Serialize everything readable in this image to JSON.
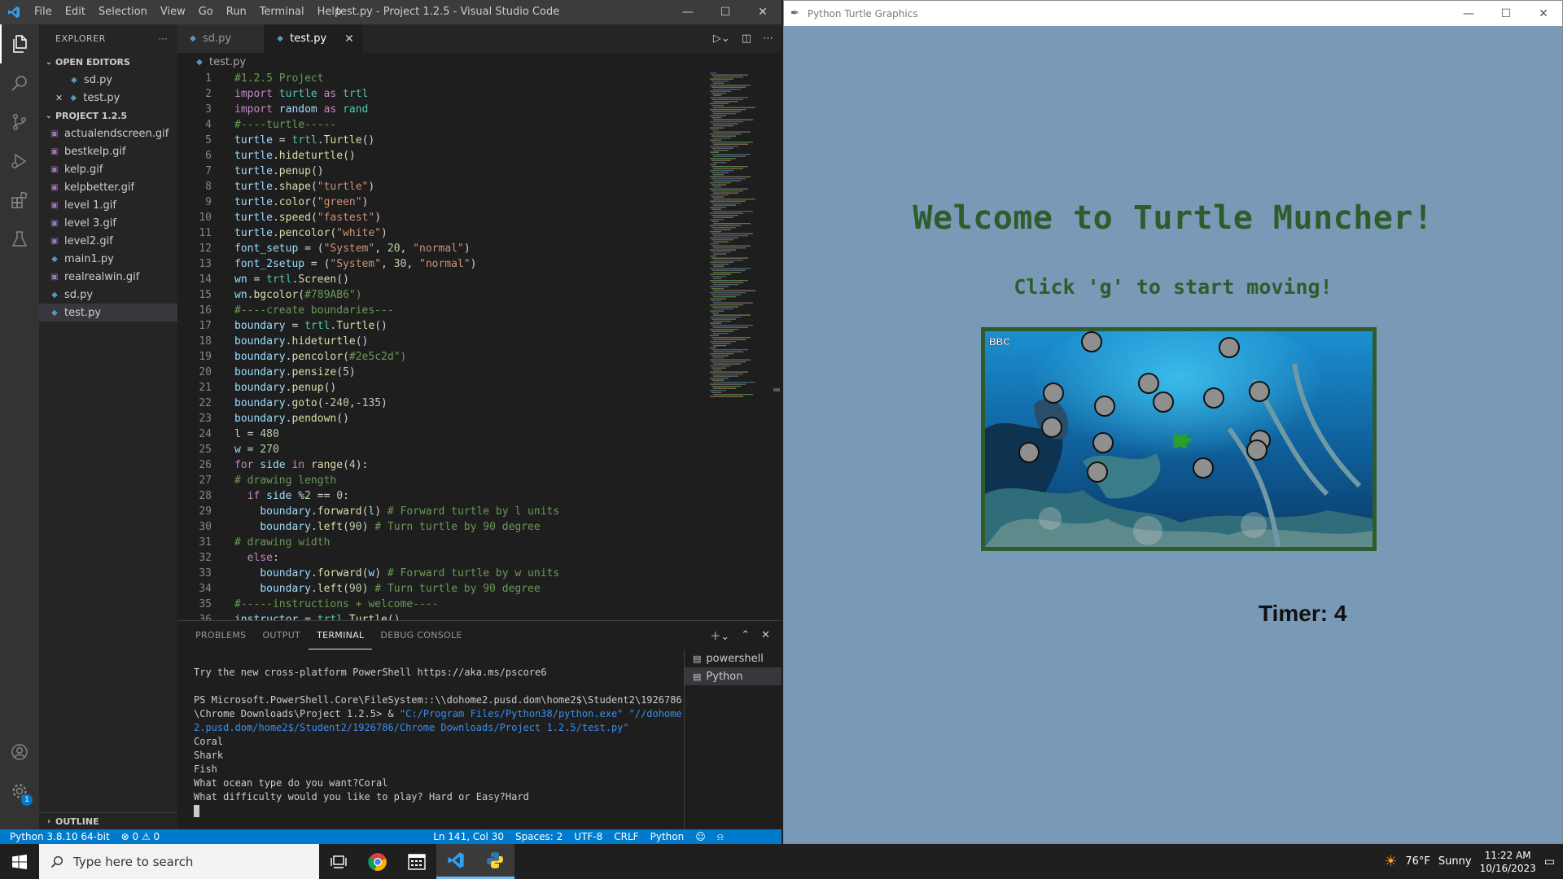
{
  "vscode": {
    "menu": [
      "File",
      "Edit",
      "Selection",
      "View",
      "Go",
      "Run",
      "Terminal",
      "Help"
    ],
    "title": "test.py - Project 1.2.5 - Visual Studio Code",
    "explorer_label": "EXPLORER",
    "open_editors_label": "OPEN EDITORS",
    "open_editors": [
      "sd.py",
      "test.py"
    ],
    "project_label": "PROJECT 1.2.5",
    "files": [
      {
        "name": "actualendscreen.gif",
        "type": "gif"
      },
      {
        "name": "bestkelp.gif",
        "type": "gif"
      },
      {
        "name": "kelp.gif",
        "type": "gif"
      },
      {
        "name": "kelpbetter.gif",
        "type": "gif"
      },
      {
        "name": "level 1.gif",
        "type": "gif"
      },
      {
        "name": "level 3.gif",
        "type": "gif"
      },
      {
        "name": "level2.gif",
        "type": "gif"
      },
      {
        "name": "main1.py",
        "type": "py"
      },
      {
        "name": "realrealwin.gif",
        "type": "gif"
      },
      {
        "name": "sd.py",
        "type": "py"
      },
      {
        "name": "test.py",
        "type": "py",
        "selected": true
      }
    ],
    "outline_label": "OUTLINE",
    "tabs": [
      {
        "label": "sd.py",
        "active": false
      },
      {
        "label": "test.py",
        "active": true
      }
    ],
    "breadcrumb": "test.py",
    "code_lines": [
      "#1.2.5 Project",
      "import turtle as trtl",
      "import random as rand",
      "#----turtle-----",
      "turtle = trtl.Turtle()",
      "turtle.hideturtle()",
      "turtle.penup()",
      "turtle.shape(\"turtle\")",
      "turtle.color(\"green\")",
      "turtle.speed(\"fastest\")",
      "turtle.pencolor(\"white\")",
      "font_setup = (\"System\", 20, \"normal\")",
      "font_2setup = (\"System\", 30, \"normal\")",
      "wn = trtl.Screen()",
      "wn.bgcolor(\"#789AB6\")",
      "#----create boundaries---",
      "boundary = trtl.Turtle()",
      "boundary.hideturtle()",
      "boundary.pencolor(\"#2e5c2d\")",
      "boundary.pensize(5)",
      "boundary.penup()",
      "boundary.goto(-240,-135)",
      "boundary.pendown()",
      "l = 480",
      "w = 270",
      "for side in range(4):",
      "# drawing length",
      "  if side %2 == 0:",
      "    boundary.forward(l) # Forward turtle by l units",
      "    boundary.left(90) # Turn turtle by 90 degree",
      "# drawing width",
      "  else:",
      "    boundary.forward(w) # Forward turtle by w units",
      "    boundary.left(90) # Turn turtle by 90 degree",
      "#-----instructions + welcome----",
      "instructor = trtl.Turtle()"
    ],
    "panel_tabs": [
      {
        "label": "PROBLEMS",
        "active": false
      },
      {
        "label": "OUTPUT",
        "active": false
      },
      {
        "label": "TERMINAL",
        "active": true
      },
      {
        "label": "DEBUG CONSOLE",
        "active": false
      }
    ],
    "terminal_lines": [
      {
        "text": "Try the new cross-platform PowerShell https://aka.ms/pscore6"
      },
      {
        "text": ""
      },
      {
        "text": "PS Microsoft.PowerShell.Core\\FileSystem::\\\\dohome2.pusd.dom\\home2$\\Student2\\1926786"
      },
      {
        "text": "\\Chrome Downloads\\Project 1.2.5> & ",
        "path": "\"C:/Program Files/Python38/python.exe\" \"//dohome"
      },
      {
        "text": "",
        "path": "2.pusd.dom/home2$/Student2/1926786/Chrome Downloads/Project 1.2.5/test.py\""
      },
      {
        "text": "Coral"
      },
      {
        "text": "Shark"
      },
      {
        "text": "Fish"
      },
      {
        "text": "What ocean type do you want?Coral"
      },
      {
        "text": "What difficulty would you like to play? Hard or Easy?Hard"
      }
    ],
    "terminal_list": [
      {
        "label": "powershell",
        "selected": false
      },
      {
        "label": "Python",
        "selected": true
      }
    ],
    "status": {
      "python": "Python 3.8.10 64-bit",
      "problems": "⊗ 0 ⚠ 0",
      "position": "Ln 141, Col 30",
      "spaces": "Spaces: 2",
      "encoding": "UTF-8",
      "eol": "CRLF",
      "language": "Python"
    },
    "accounts_badge": "1"
  },
  "turtle_window": {
    "title": "Python Turtle Graphics",
    "welcome": "Welcome to Turtle Muncher!",
    "instructions": "Click 'g' to start moving!",
    "timer": "Timer: 4",
    "watermark": "BBC",
    "background": "#789AB6",
    "border_color": "#2e5c2d"
  },
  "taskbar": {
    "search_placeholder": "Type here to search",
    "weather_temp": "76°F",
    "weather_desc": "Sunny",
    "time": "11:22 AM",
    "date": "10/16/2023"
  }
}
